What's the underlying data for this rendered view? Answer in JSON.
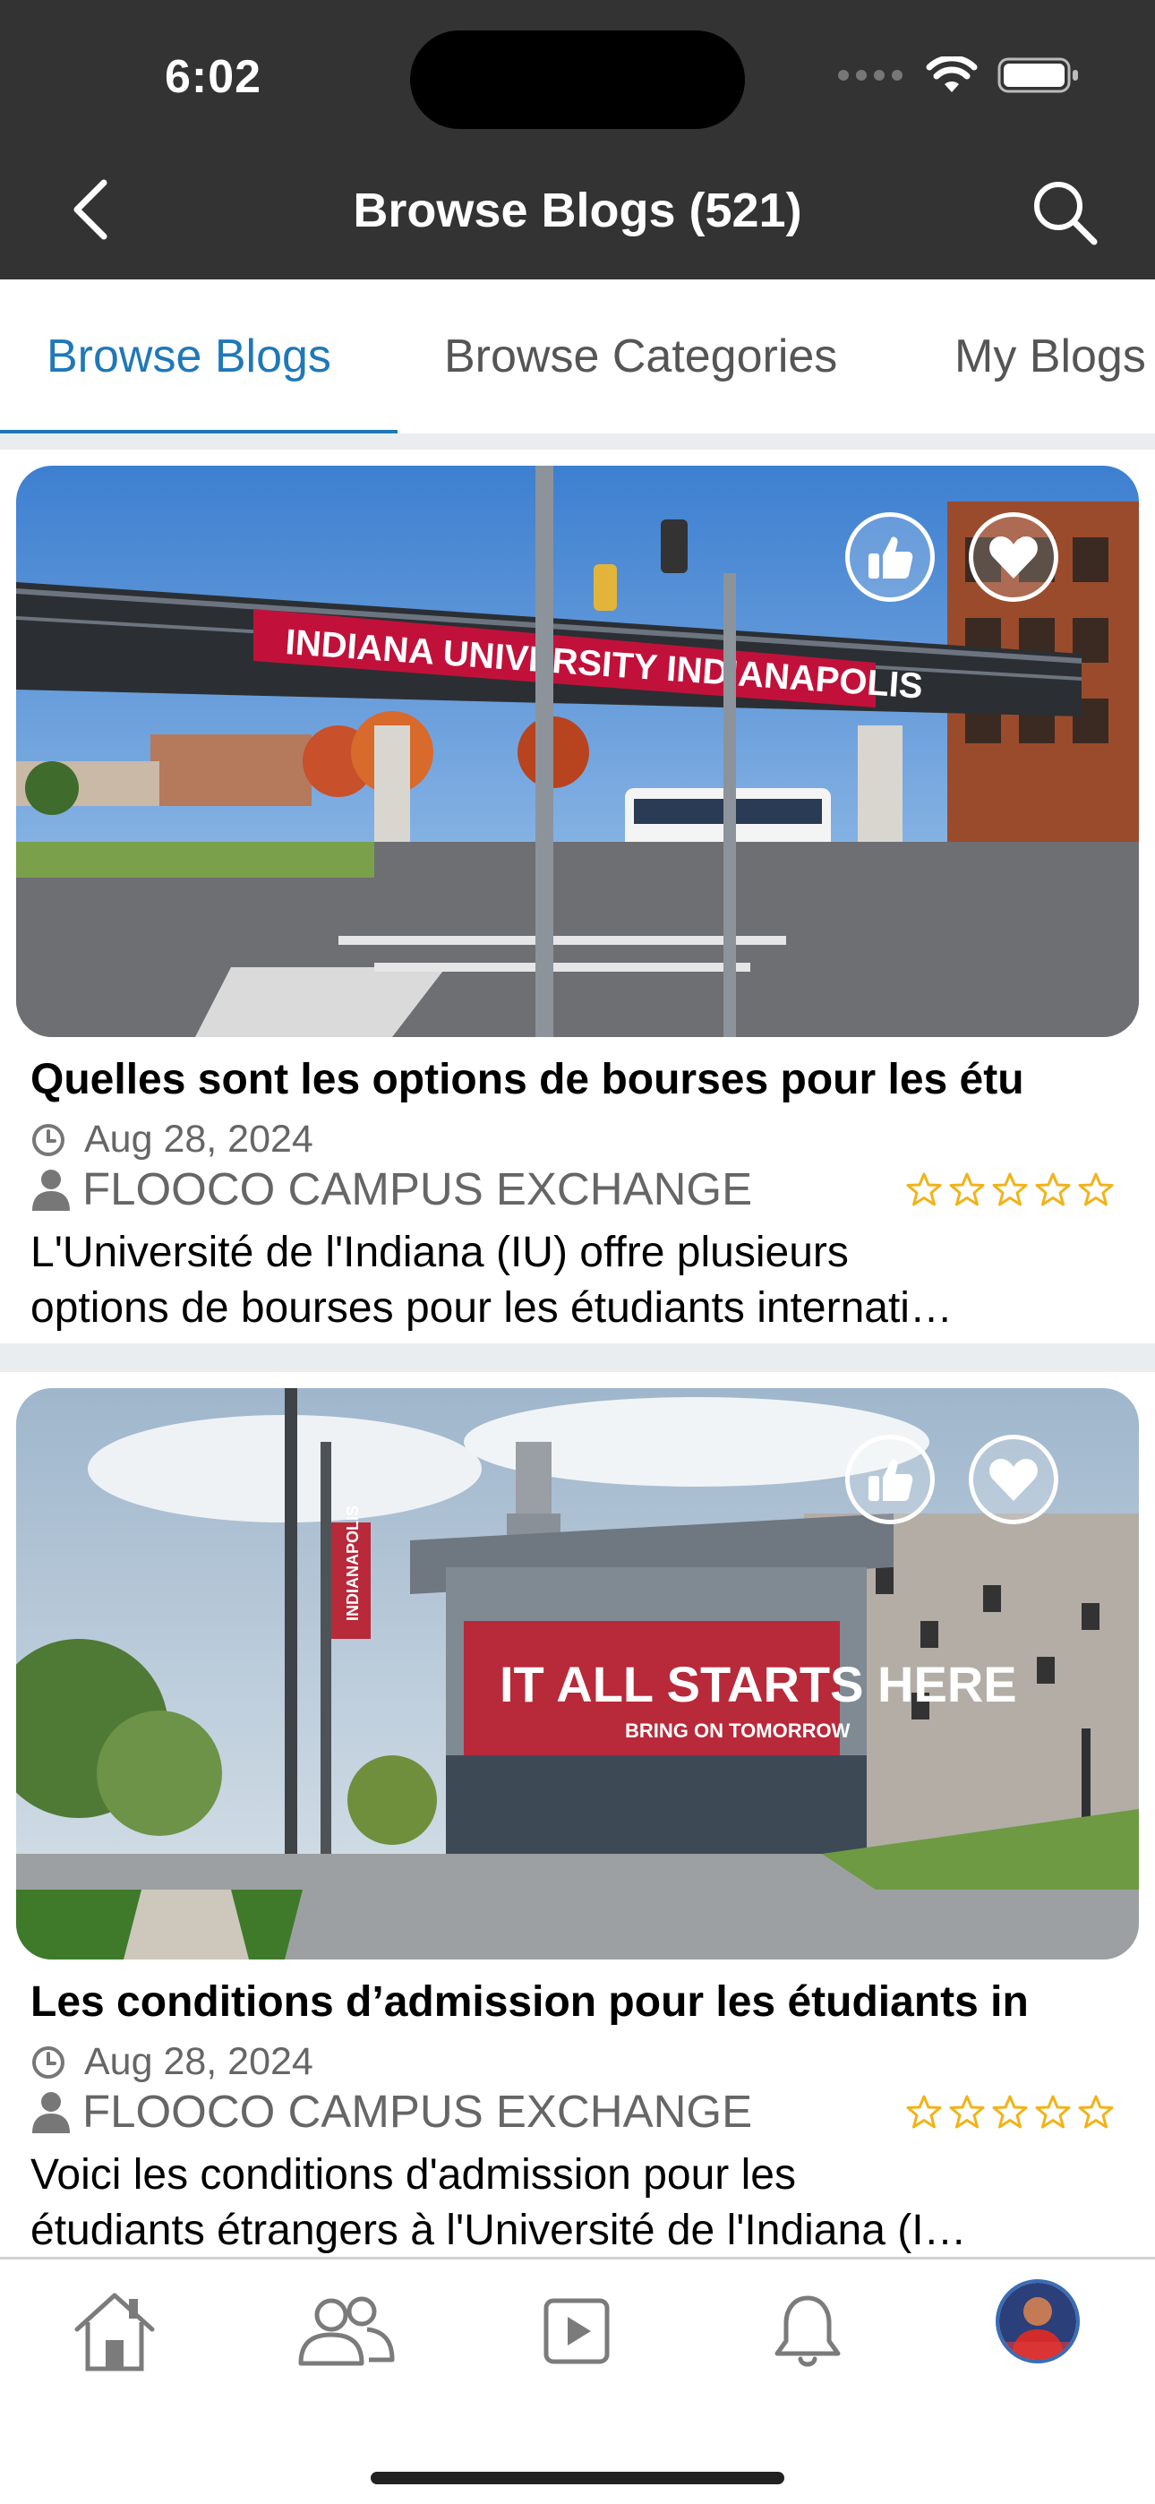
{
  "status_bar": {
    "time": "6:02"
  },
  "nav": {
    "title": "Browse Blogs (521)",
    "back_icon": "chevron-left-icon",
    "search_icon": "search-icon"
  },
  "tabs": [
    {
      "label": "Browse Blogs",
      "active": true
    },
    {
      "label": "Browse Categories",
      "active": false
    },
    {
      "label": "My Blogs",
      "active": false
    }
  ],
  "blogs": [
    {
      "title": "Quelles sont les options de bourses pour les étu",
      "date": "Aug 28, 2024",
      "author": "FLOOCO CAMPUS EXCHANGE",
      "rating": 0,
      "excerpt_line1": "L'Université de l'Indiana (IU) offre plusieurs",
      "excerpt_line2": "options de bourses pour les étudiants internati…",
      "image_banner": "INDIANA UNIVERSITY INDIANAPOLIS"
    },
    {
      "title": "Les conditions d’admission pour les étudiants in",
      "date": "Aug 28, 2024",
      "author": "FLOOCO CAMPUS EXCHANGE",
      "rating": 0,
      "excerpt_line1": "Voici les conditions d'admission pour les",
      "excerpt_line2": "étudiants étrangers à l'Université de l'Indiana (I…",
      "image_banner": "IT ALL STARTS HERE",
      "image_sub": "BRING ON TOMORROW",
      "image_flag": "INDIANAPOLIS"
    }
  ],
  "bottom_nav": [
    {
      "icon": "home-icon"
    },
    {
      "icon": "people-icon"
    },
    {
      "icon": "video-icon"
    },
    {
      "icon": "bell-icon"
    },
    {
      "icon": "profile-avatar"
    }
  ],
  "colors": {
    "header_bg": "#333333",
    "accent": "#1f78b8",
    "star": "#f2b318",
    "separator": "#e9edf0"
  }
}
